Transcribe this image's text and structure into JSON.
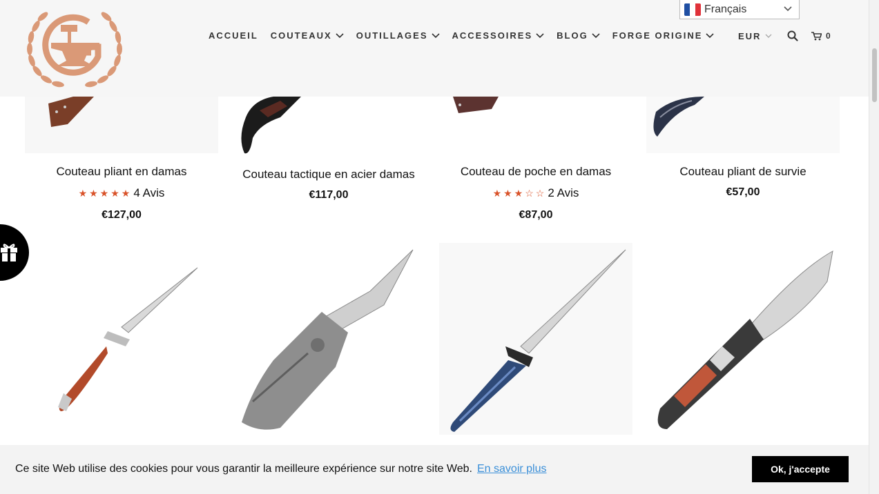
{
  "language": {
    "selected": "Français",
    "flag_colors": [
      "#1f4fa3",
      "#ffffff",
      "#e0323a"
    ]
  },
  "nav": {
    "items": [
      {
        "label": "ACCUEIL",
        "has_dropdown": false
      },
      {
        "label": "COUTEAUX",
        "has_dropdown": true
      },
      {
        "label": "OUTILLAGES",
        "has_dropdown": true
      },
      {
        "label": "ACCESSOIRES",
        "has_dropdown": true
      },
      {
        "label": "BLOG",
        "has_dropdown": true
      },
      {
        "label": "FORGE ORIGINE",
        "has_dropdown": true
      }
    ],
    "currency": "EUR",
    "cart_count": "0"
  },
  "products_row1": [
    {
      "title": "Couteau pliant en damas",
      "rating": 5,
      "reviews": "4 Avis",
      "price": "€127,00"
    },
    {
      "title": "Couteau tactique en acier damas",
      "price": "€117,00"
    },
    {
      "title": "Couteau de poche en damas",
      "rating": 3,
      "reviews": "2 Avis",
      "price": "€87,00"
    },
    {
      "title": "Couteau pliant de survie",
      "price": "€57,00"
    }
  ],
  "products_row2": [
    {
      "image": "stiletto-knife-wood-handle"
    },
    {
      "image": "tactical-knife-grey"
    },
    {
      "image": "stiletto-knife-blue-handle"
    },
    {
      "image": "folding-knife-engraved-handle"
    }
  ],
  "cookie": {
    "text": "Ce site Web utilise des cookies pour vous garantir la meilleure expérience sur notre site Web.",
    "link": "En savoir plus",
    "button": "Ok, j'accepte"
  },
  "colors": {
    "accent_stars": "#d9532a",
    "logo_copper": "#d8906a",
    "link": "#3a8fd8"
  }
}
